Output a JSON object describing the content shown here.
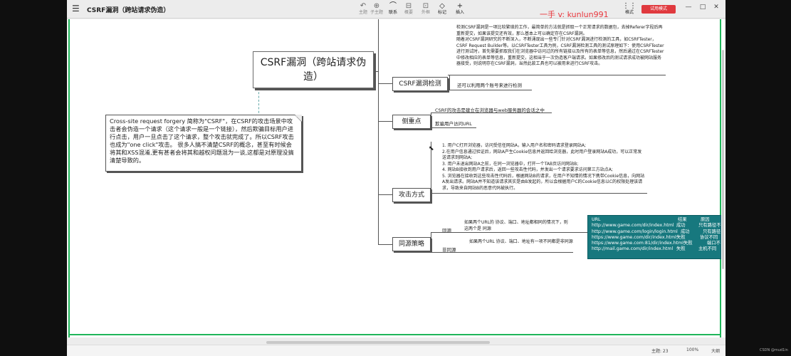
{
  "app": {
    "doc_title": "CSRF漏洞（跨站请求伪造）",
    "watermark": "一手  v: kunlun991",
    "trial_label": "试用模式",
    "toolbar": [
      {
        "icon": "↶",
        "label": "主题"
      },
      {
        "icon": "⊕",
        "label": "子主题"
      },
      {
        "icon": "⌒",
        "label": "联系"
      },
      {
        "icon": "⊟",
        "label": "概要"
      },
      {
        "icon": "⊡",
        "label": "外框"
      },
      {
        "icon": "◇",
        "label": "标记"
      },
      {
        "icon": "+",
        "label": "插入"
      }
    ],
    "format_label": "格式",
    "format_icon": "⋮⋮",
    "window_controls": [
      "—",
      "□",
      "✕"
    ],
    "status": {
      "topics": "主题: 23",
      "zoom": "100%",
      "size": "大纲"
    },
    "blog_mark": "CSDN @mud1in"
  },
  "mindmap": {
    "root": "CSRF漏洞（跨站请求伪造）",
    "note": "Cross-site request forgery 简称为\"CSRF\"，在CSRF的攻击场景中攻击者会伪造一个请求（这个请求一般是一个链接），然后欺骗目标用户进行点击，用户一旦点击了这个请求，整个攻击就完成了。所以CSRF攻击也成为\"one click\"攻击。 很多人搞不清楚CSRF的概念，甚至有时候会将其和XSS混淆,更有甚者会将其和越权问题混为一谈,这都是对原理没搞清楚导致的。",
    "branches": [
      {
        "label": "CSRF漏洞检测",
        "detail": "检测CSRF漏洞是一项比较繁琐的工作，最简单的方法就是抓取一个正常请求的数据包，去掉Referer字段后再重新提交，如果该提交还有效，那么基本上可以确定存在CSRF漏洞。\n随着对CSRF漏洞研究的不断深入，不断涌现出一些专门针对CSRF漏洞进行检测的工具，如CSRFTester，CSRF Request Builder等。以CSRFTester工具为例，CSRF漏洞检测工具的测试原理如下：使用CSRFTester进行测试时，首先需要抓取我们在浏览器中访问过的所有链接以及所有的表单等信息，然后通过在CSRFTester中修改相应的表单等信息，重新提交，这相当于一次伪造客户端请求。如果修改后的测试请求成功被网站服务器接受，则说明存在CSRF漏洞，当然此款工具也可以被用来进行CSRF攻击。",
        "sub": "还可以利用两个账号来进行检测"
      },
      {
        "label": "侧重点",
        "sub1": "CSRF的攻击是建立在浏览器与web服务器的会话之中",
        "sub2": "欺骗用户访问URL"
      },
      {
        "label": "攻击方式",
        "steps": [
          "1. 用户C打开浏览器，访问受信任网站A，输入用户名和密码请求登录网站A;",
          "2.在用户信息通过验证后，网站A产生Cookie信息并返回给浏览器，此时用户登录网站A成功，可以正常发送请求到网站A;",
          "3. 用户未退出网站A之前，在同一浏览器中，打开一个TAB页访问网站B;",
          "4. 网站B接收到用户请求后，返回一些攻击性代码，并发出一个请求要求访问第三方站点A;",
          "5. 浏览器在接收到这些攻击性代码后，根据网站B的请求，在用户不知情的情况下携带Cookie信息，向网站A发出请求。网站A并不知道该请求其实是由B发起的，所以会根据用户C的Cookie信息以C的权限处理该请求，导致来自网站B的恶意代码被执行。"
        ]
      },
      {
        "label": "同源策略",
        "same_label": "同源",
        "same_desc": "如果两个URL的 协议、端口、地址都相同的情况下，则这两个是 同源",
        "diff_label": "非同源",
        "diff_desc": "如果两个URL 协议、端口、地址有一项不同都是非同源"
      }
    ],
    "table": {
      "headers": [
        "URL",
        "结果",
        "原因"
      ],
      "rows": [
        [
          "http://www.game.com/dir/index.html",
          "成功",
          "只有路径不"
        ],
        [
          "http://www.game.com/login/login.html",
          "成功",
          "只有路径"
        ],
        [
          "https://www.game.com/dir/index.html",
          "失败",
          "协议不同"
        ],
        [
          "https://www.game.com:81/dir/index.html",
          "失败",
          "端口不"
        ],
        [
          "http://mail.game.com/dir/index.html",
          "失败",
          "主机不同"
        ]
      ]
    }
  }
}
